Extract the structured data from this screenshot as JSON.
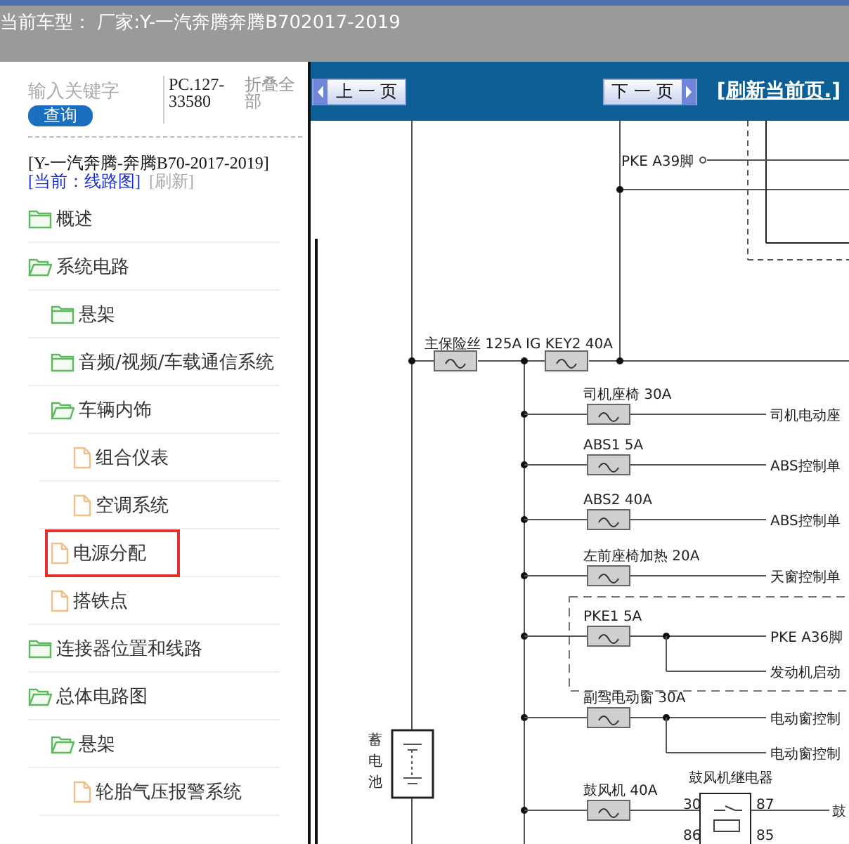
{
  "header": {
    "title": "当前车型： 厂家:Y-一汽奔腾奔腾B702017-2019"
  },
  "sidebar": {
    "search": {
      "placeholder": "输入关键字"
    },
    "search_button": "查询",
    "code": "PC.127-33580",
    "collapse_all": "折叠全部",
    "model": "[Y-一汽奔腾-奔腾B70-2017-2019]",
    "current": "[当前：线路图]",
    "refresh": "[刷新]",
    "tree": [
      {
        "label": "概述",
        "kind": "folder",
        "expanded": false,
        "selected": false
      },
      {
        "label": "系统电路",
        "kind": "folder",
        "expanded": true,
        "selected": false,
        "children": [
          {
            "label": "悬架",
            "kind": "folder",
            "expanded": false,
            "selected": false
          },
          {
            "label": "音频/视频/车载通信系统",
            "kind": "folder",
            "expanded": false,
            "selected": false
          },
          {
            "label": "车辆内饰",
            "kind": "folder",
            "expanded": true,
            "selected": false,
            "children": [
              {
                "label": "组合仪表",
                "kind": "document",
                "selected": false
              },
              {
                "label": "空调系统",
                "kind": "document",
                "selected": false
              }
            ]
          },
          {
            "label": "电源分配",
            "kind": "document",
            "selected": true
          },
          {
            "label": "搭铁点",
            "kind": "document",
            "selected": false
          }
        ]
      },
      {
        "label": "连接器位置和线路",
        "kind": "folder",
        "expanded": false,
        "selected": false
      },
      {
        "label": "总体电路图",
        "kind": "folder",
        "expanded": true,
        "selected": false,
        "children": [
          {
            "label": "悬架",
            "kind": "folder",
            "expanded": true,
            "selected": false,
            "children": [
              {
                "label": "轮胎气压报警系统",
                "kind": "document",
                "selected": false
              }
            ]
          }
        ]
      }
    ]
  },
  "toolbar": {
    "prev_button": "上 一 页",
    "next_button": "下 一 页",
    "refresh_link": "[刷新当前页.]"
  },
  "diagram": {
    "pke_pin": "PKE A39脚",
    "main_fuses": [
      "主保险丝 125A",
      "IG KEY2 40A"
    ],
    "battery": "蓄电池",
    "branches": [
      {
        "kind": "plain",
        "fuse": "司机座椅 30A",
        "outputs": [
          "司机电动座"
        ]
      },
      {
        "kind": "plain",
        "fuse": "ABS1  5A",
        "outputs": [
          "ABS控制单"
        ]
      },
      {
        "kind": "plain",
        "fuse": "ABS2  40A",
        "outputs": [
          "ABS控制单"
        ]
      },
      {
        "kind": "plain",
        "fuse": "左前座椅加热 20A",
        "outputs": [
          "天窗控制单"
        ]
      },
      {
        "kind": "plain",
        "fuse": "PKE1  5A",
        "outputs": [
          "PKE A36脚",
          "发动机启动"
        ]
      },
      {
        "kind": "plain",
        "fuse": "副驾电动窗 30A",
        "outputs": [
          "电动窗控制",
          "电动窗控制"
        ]
      },
      {
        "kind": "relay",
        "fuse": "鼓风机 40A",
        "relay": "鼓风机继电器",
        "pins": [
          "30",
          "87",
          "86",
          "85"
        ],
        "outputs": [
          "鼓"
        ]
      }
    ]
  }
}
